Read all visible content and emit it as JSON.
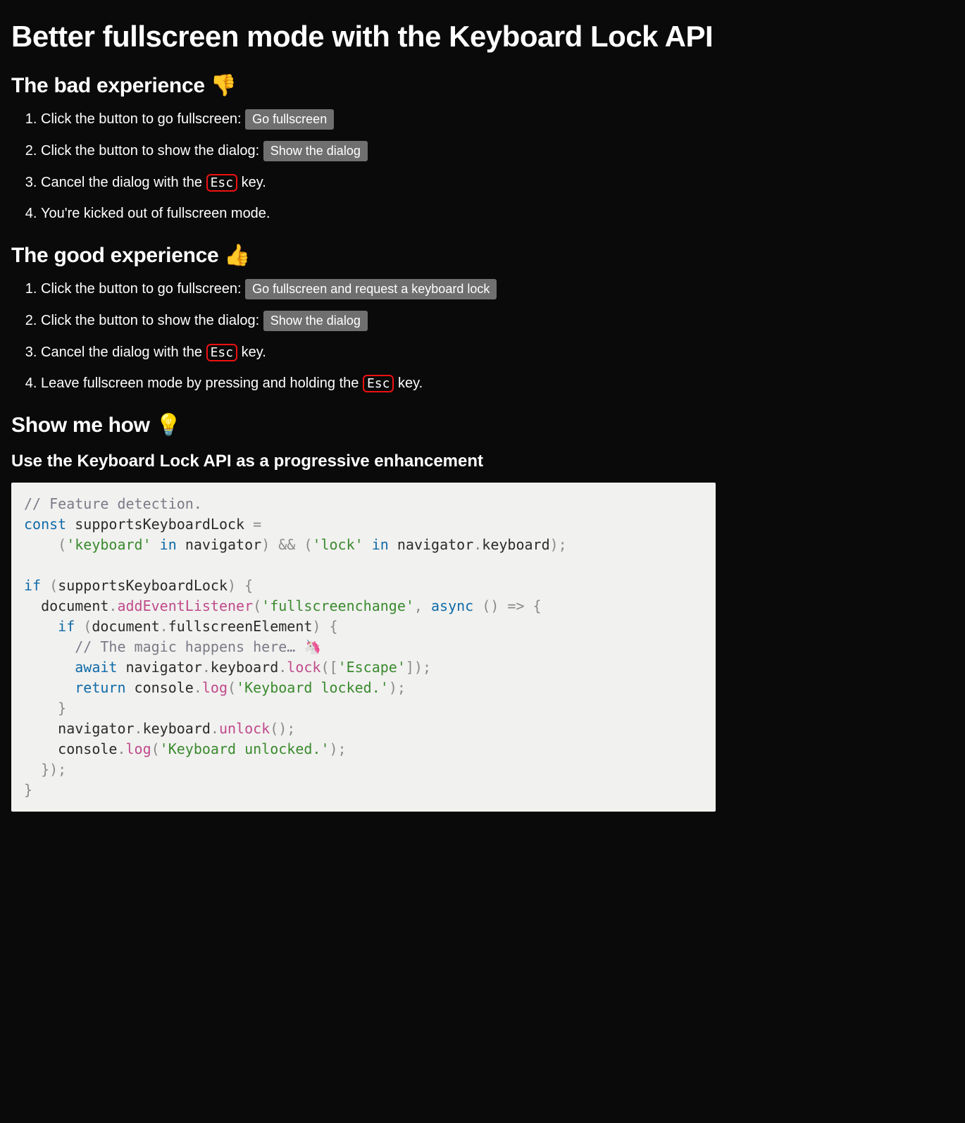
{
  "title": "Better fullscreen mode with the Keyboard Lock API",
  "bad": {
    "heading": "The bad experience 👎",
    "steps": {
      "s1_pre": "Click the button to go fullscreen: ",
      "s1_btn": "Go fullscreen",
      "s2_pre": "Click the button to show the dialog: ",
      "s2_btn": "Show the dialog",
      "s3_pre": "Cancel the dialog with the ",
      "s3_kbd": "Esc",
      "s3_post": " key.",
      "s4": "You're kicked out of fullscreen mode."
    }
  },
  "good": {
    "heading": "The good experience 👍",
    "steps": {
      "s1_pre": "Click the button to go fullscreen: ",
      "s1_btn": "Go fullscreen and request a keyboard lock",
      "s2_pre": "Click the button to show the dialog: ",
      "s2_btn": "Show the dialog",
      "s3_pre": "Cancel the dialog with the ",
      "s3_kbd": "Esc",
      "s3_post": " key.",
      "s4_pre": "Leave fullscreen mode by pressing and holding the ",
      "s4_kbd": "Esc",
      "s4_post": " key."
    }
  },
  "how": {
    "heading": "Show me how 💡",
    "subheading": "Use the Keyboard Lock API as a progressive enhancement"
  },
  "code": {
    "c1": "// Feature detection.",
    "kw_const": "const",
    "id_supports": "supportsKeyboardLock",
    "eq": " =",
    "p_open1": "    (",
    "str_keyboard": "'keyboard'",
    "kw_in1": " in ",
    "id_nav1": "navigator",
    "p_close_and": ") && (",
    "str_lock": "'lock'",
    "kw_in2": " in ",
    "id_nav2": "navigator",
    "dot1": ".",
    "id_keyboard1": "keyboard",
    "p_close_semi": ");",
    "kw_if": "if",
    "p_if_open": " (",
    "id_supports2": "supportsKeyboardLock",
    "p_if_close": ") {",
    "id_document1": "  document",
    "dot2": ".",
    "m_addEvent": "addEventListener",
    "p_ael_open": "(",
    "str_fsc": "'fullscreenchange'",
    "comma_async": ", ",
    "kw_async": "async",
    "arrow": " () => {",
    "kw_if2": "    if",
    "p_if2_open": " (",
    "id_document2": "document",
    "dot3": ".",
    "id_fse": "fullscreenElement",
    "p_if2_close": ") {",
    "c2": "      // The magic happens here… 🦄",
    "kw_await": "      await",
    "sp1": " ",
    "id_nav3": "navigator",
    "dot4": ".",
    "id_keyboard2": "keyboard",
    "dot5": ".",
    "m_lock": "lock",
    "p_lock_open": "([",
    "str_escape": "'Escape'",
    "p_lock_close": "]);",
    "kw_return": "      return",
    "sp2": " ",
    "id_console1": "console",
    "dot6": ".",
    "m_log1": "log",
    "p_log1_open": "(",
    "str_locked": "'Keyboard locked.'",
    "p_log1_close": ");",
    "brace_close1": "    }",
    "id_nav4": "    navigator",
    "dot7": ".",
    "id_keyboard3": "keyboard",
    "dot8": ".",
    "m_unlock": "unlock",
    "p_unlock": "();",
    "id_console2": "    console",
    "dot9": ".",
    "m_log2": "log",
    "p_log2_open": "(",
    "str_unlocked": "'Keyboard unlocked.'",
    "p_log2_close": ");",
    "brace_close2": "  });",
    "brace_close3": "}"
  }
}
